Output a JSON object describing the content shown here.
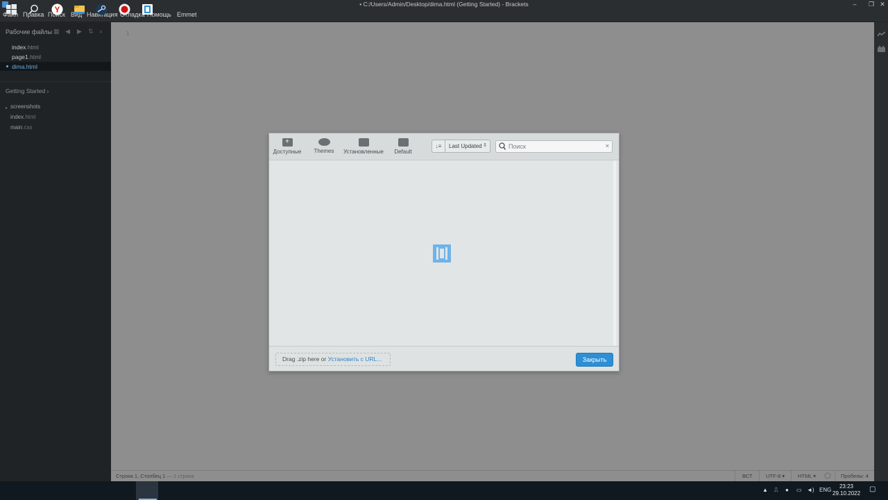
{
  "window": {
    "title": "• C:/Users/Admin/Desktop/dima.html (Getting Started) - Brackets",
    "controls": [
      "–",
      "❐",
      "✕"
    ]
  },
  "menu": [
    "Файл",
    "Правка",
    "Поиск",
    "Вид",
    "Навигация",
    "Отладка",
    "Помощь",
    "Emmet"
  ],
  "sidebar": {
    "working_files_title": "Рабочие файлы",
    "working_files": [
      {
        "name": "index",
        "ext": ".html",
        "active": false
      },
      {
        "name": "page1",
        "ext": ".html",
        "active": false
      },
      {
        "name": "dima",
        "ext": ".html",
        "active": true
      }
    ],
    "project_title": "Getting Started ›",
    "tree": [
      {
        "name": "screenshots",
        "ext": "",
        "folder": true
      },
      {
        "name": "index",
        "ext": ".html",
        "folder": false
      },
      {
        "name": "main",
        "ext": ".css",
        "folder": false
      }
    ]
  },
  "editor": {
    "line_number": "1"
  },
  "statusbar": {
    "cursor": "Строка 1, Столбец 1",
    "lines": "— 1 строка",
    "insert_mode": "ВСТ",
    "encoding": "UTF-8 ▾",
    "language": "HTML ▾",
    "spaces": "Пробелы: 4"
  },
  "extension_manager": {
    "tabs": [
      {
        "label": "Доступные",
        "icon": "add-box-icon"
      },
      {
        "label": "Themes",
        "icon": "palette-icon"
      },
      {
        "label": "Установленные",
        "icon": "package-icon"
      },
      {
        "label": "Default",
        "icon": "package-icon"
      }
    ],
    "sort_label": "Last Updated",
    "sort_icon": "sort-icon",
    "search_placeholder": "Поиск",
    "search_value": "",
    "clear_symbol": "×",
    "drop_text": "Drag .zip here or ",
    "install_url_label": "Установить с URL...",
    "close_label": "Закрыть",
    "accent_color": "#2d8fd5"
  },
  "taskbar": {
    "apps": [
      "start-icon",
      "search-icon",
      "yandex-browser-icon",
      "file-explorer-icon",
      "steam-icon",
      "obs-icon",
      "brackets-icon"
    ],
    "language": "ENG",
    "time": "23:23",
    "date": "29.10.2022"
  }
}
